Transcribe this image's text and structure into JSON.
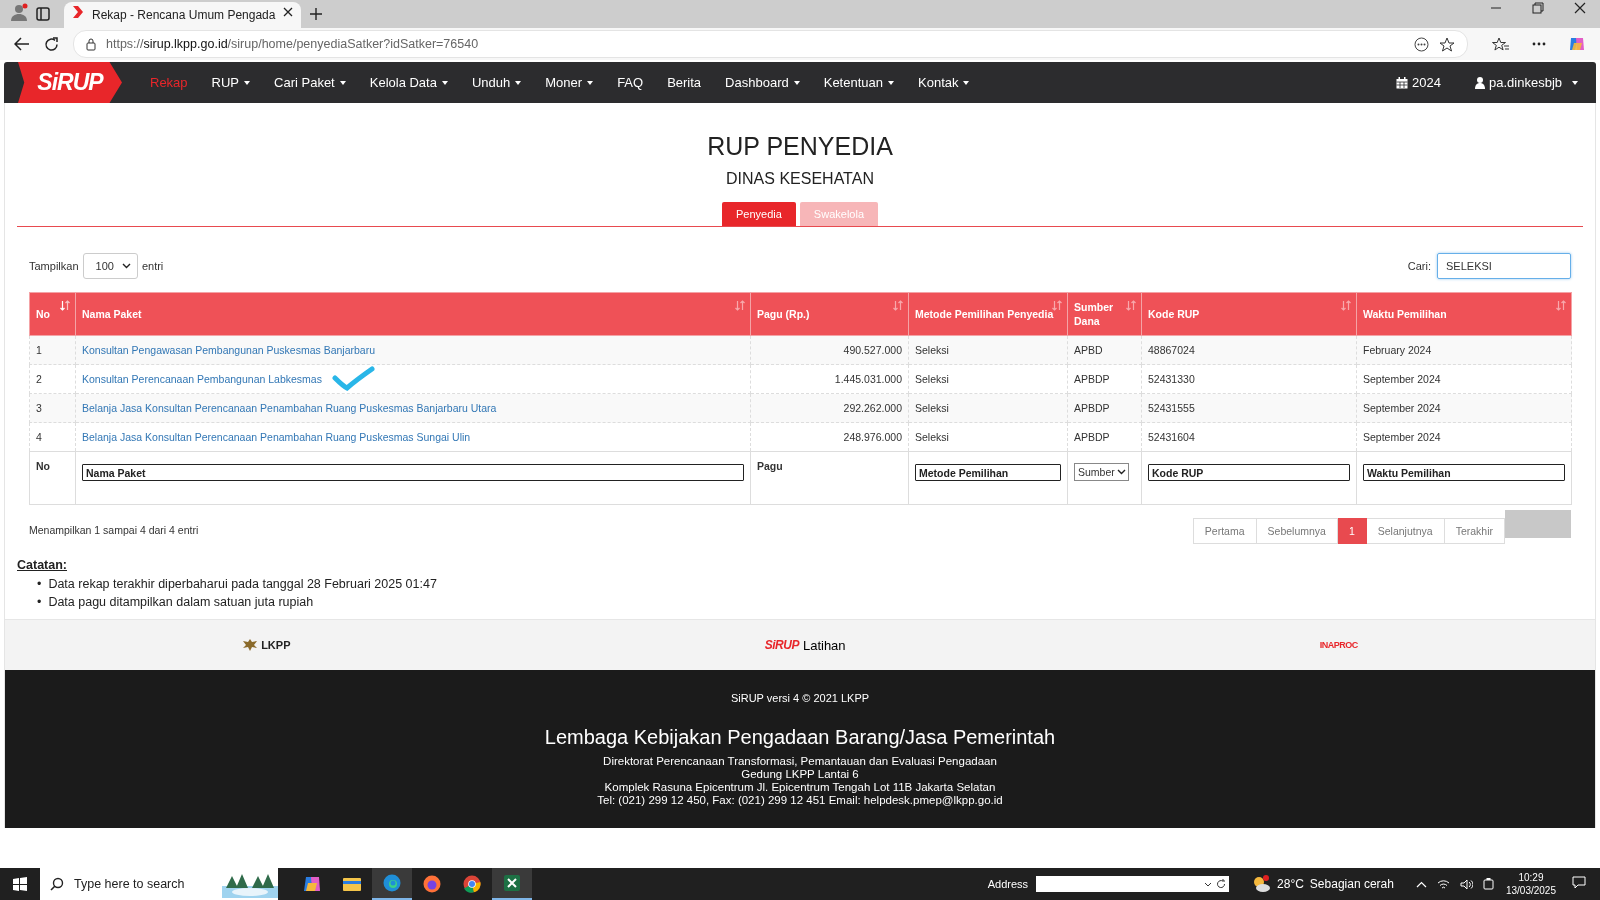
{
  "browser": {
    "tab_title": "Rekap - Rencana Umum Pengada",
    "url_scheme": "https://",
    "url_host": "sirup.lkpp.go.id",
    "url_path": "/sirup/home/penyediaSatker?idSatker=76540"
  },
  "navbar": {
    "logo": "SiRUP",
    "items": [
      {
        "label": "Rekap",
        "selected": true,
        "dropdown": false
      },
      {
        "label": "RUP",
        "selected": false,
        "dropdown": true
      },
      {
        "label": "Cari Paket",
        "selected": false,
        "dropdown": true
      },
      {
        "label": "Kelola Data",
        "selected": false,
        "dropdown": true
      },
      {
        "label": "Unduh",
        "selected": false,
        "dropdown": true
      },
      {
        "label": "Moner",
        "selected": false,
        "dropdown": true
      },
      {
        "label": "FAQ",
        "selected": false,
        "dropdown": false
      },
      {
        "label": "Berita",
        "selected": false,
        "dropdown": false
      },
      {
        "label": "Dashboard",
        "selected": false,
        "dropdown": true
      },
      {
        "label": "Ketentuan",
        "selected": false,
        "dropdown": true
      },
      {
        "label": "Kontak",
        "selected": false,
        "dropdown": true
      }
    ],
    "year": "2024",
    "user": "pa.dinkesbjb"
  },
  "page": {
    "title": "RUP PENYEDIA",
    "subtitle": "DINAS KESEHATAN",
    "tabs": [
      {
        "label": "Penyedia",
        "selected": true
      },
      {
        "label": "Swakelola",
        "selected": false
      }
    ]
  },
  "table_controls": {
    "show_label": "Tampilkan",
    "page_size": "100",
    "entries_label": "entri",
    "search_label": "Cari:",
    "search_value": "SELEKSI"
  },
  "table": {
    "columns": [
      {
        "label": "No",
        "sorted": true
      },
      {
        "label": "Nama Paket",
        "sorted": false
      },
      {
        "label": "Pagu (Rp.)",
        "sorted": false
      },
      {
        "label": "Metode Pemilihan Penyedia",
        "sorted": false
      },
      {
        "label": "Sumber Dana",
        "sorted": false
      },
      {
        "label": "Kode RUP",
        "sorted": false
      },
      {
        "label": "Waktu Pemilihan",
        "sorted": false
      }
    ],
    "rows": [
      [
        "1",
        "Konsultan Pengawasan Pembangunan Puskesmas Banjarbaru",
        "490.527.000",
        "Seleksi",
        "APBD",
        "48867024",
        "February 2024"
      ],
      [
        "2",
        "Konsultan Perencanaan Pembangunan Labkesmas",
        "1.445.031.000",
        "Seleksi",
        "APBDP",
        "52431330",
        "September 2024"
      ],
      [
        "3",
        "Belanja Jasa Konsultan Perencanaan Penambahan Ruang Puskesmas Banjarbaru Utara",
        "292.262.000",
        "Seleksi",
        "APBDP",
        "52431555",
        "September 2024"
      ],
      [
        "4",
        "Belanja Jasa Konsultan Perencanaan Penambahan Ruang Puskesmas Sungai Ulin",
        "248.976.000",
        "Seleksi",
        "APBDP",
        "52431604",
        "September 2024"
      ]
    ],
    "filters": [
      {
        "kind": "label",
        "text": "No"
      },
      {
        "kind": "input",
        "placeholder": "Nama Paket"
      },
      {
        "kind": "label",
        "text": "Pagu"
      },
      {
        "kind": "input",
        "placeholder": "Metode Pemilihan"
      },
      {
        "kind": "select",
        "value": "Sumber"
      },
      {
        "kind": "input",
        "placeholder": "Kode RUP"
      },
      {
        "kind": "input",
        "placeholder": "Waktu Pemilihan"
      }
    ]
  },
  "table_info": "Menampilkan 1 sampai 4 dari 4 entri",
  "pagination": [
    {
      "label": "Pertama",
      "selected": false
    },
    {
      "label": "Sebelumnya",
      "selected": false
    },
    {
      "label": "1",
      "selected": true
    },
    {
      "label": "Selanjutnya",
      "selected": false
    },
    {
      "label": "Terakhir",
      "selected": false
    }
  ],
  "notes": {
    "title": "Catatan:",
    "bullet": "•",
    "items": [
      "Data rekap terakhir diperbaharui pada tanggal 28 Februari 2025 01:47",
      "Data pagu ditampilkan dalam satuan juta rupiah"
    ]
  },
  "partner_logos": {
    "lkpp": "LKPP",
    "sirup": "SiRUP",
    "sirup_caption": "Latihan",
    "inaproc": "INAPROC"
  },
  "footer": {
    "version": "SiRUP versi 4 © 2021 LKPP",
    "org": "Lembaga Kebijakan Pengadaan Barang/Jasa Pemerintah",
    "lines": [
      "Direktorat Perencanaan Transformasi, Pemantauan dan Evaluasi Pengadaan",
      "Gedung LKPP Lantai 6",
      "Komplek Rasuna Epicentrum Jl. Epicentrum Tengah Lot 11B Jakarta Selatan",
      "Tel: (021) 299 12 450, Fax: (021) 299 12 451 Email: helpdesk.pmep@lkpp.go.id"
    ]
  },
  "taskbar": {
    "search_placeholder": "Type here to search",
    "address_label": "Address",
    "temperature": "28°C",
    "weather": "Sebagian cerah",
    "time": "10:29",
    "date": "13/03/2025"
  }
}
